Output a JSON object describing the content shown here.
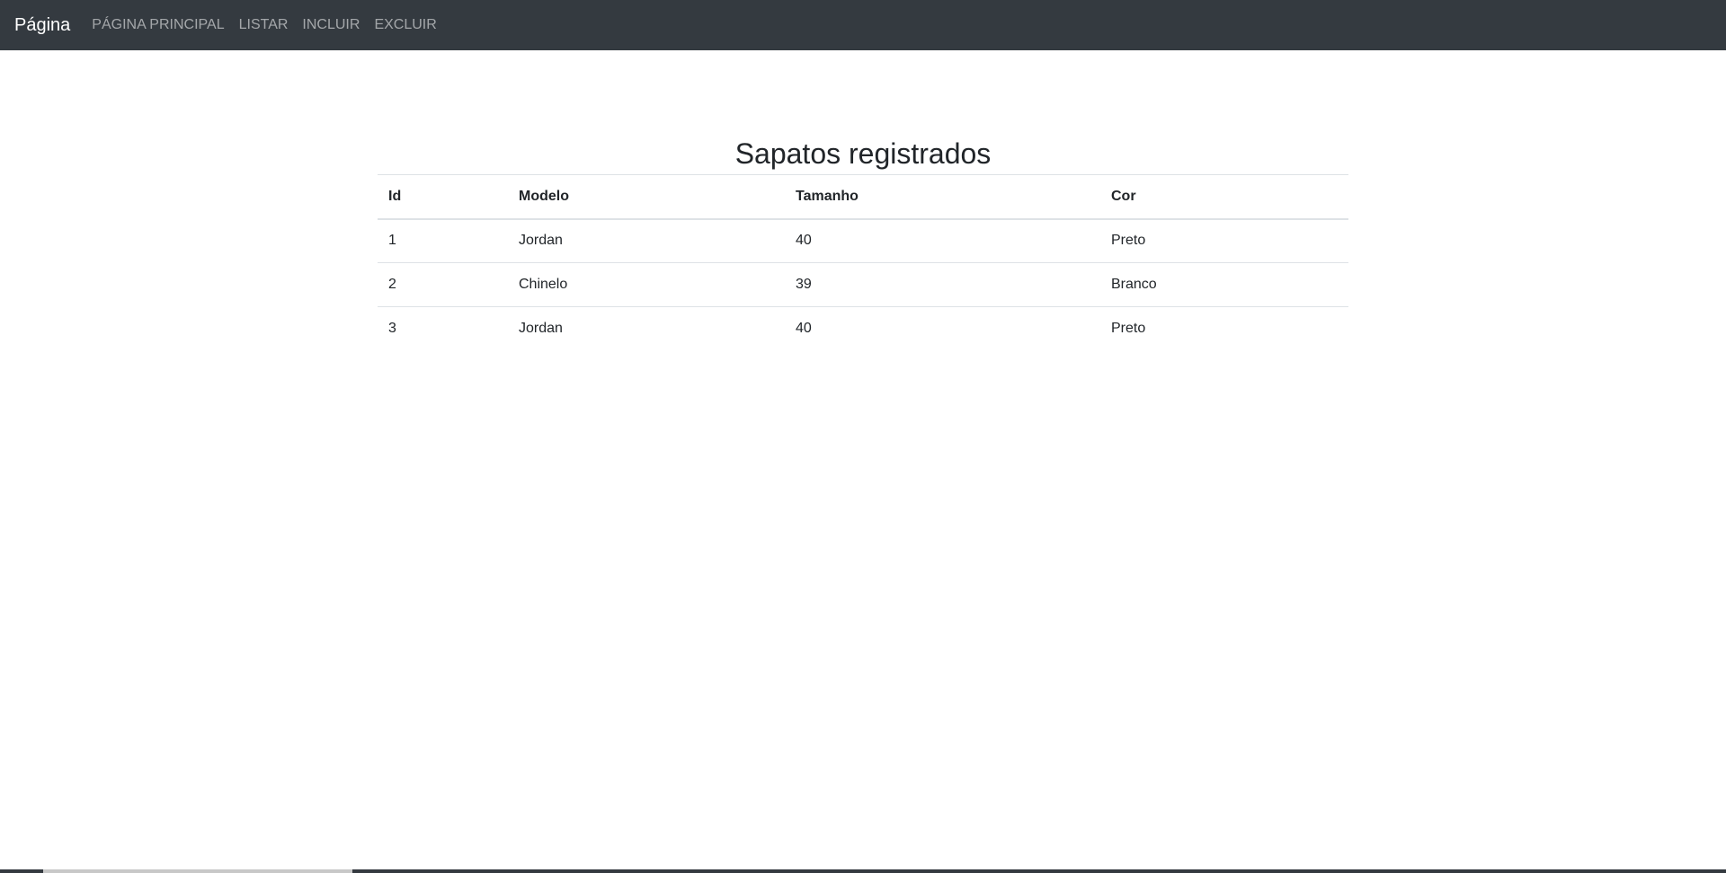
{
  "navbar": {
    "brand": "Página",
    "links": [
      "PÁGINA PRINCIPAL",
      "LISTAR",
      "INCLUIR",
      "EXCLUIR"
    ]
  },
  "main": {
    "title": "Sapatos registrados",
    "table": {
      "headers": [
        "Id",
        "Modelo",
        "Tamanho",
        "Cor"
      ],
      "rows": [
        [
          "1",
          "Jordan",
          "40",
          "Preto"
        ],
        [
          "2",
          "Chinelo",
          "39",
          "Branco"
        ],
        [
          "3",
          "Jordan",
          "40",
          "Preto"
        ]
      ]
    }
  },
  "colors": {
    "navbar_bg": "#343a40",
    "text": "#212529",
    "border": "#dee2e6"
  }
}
